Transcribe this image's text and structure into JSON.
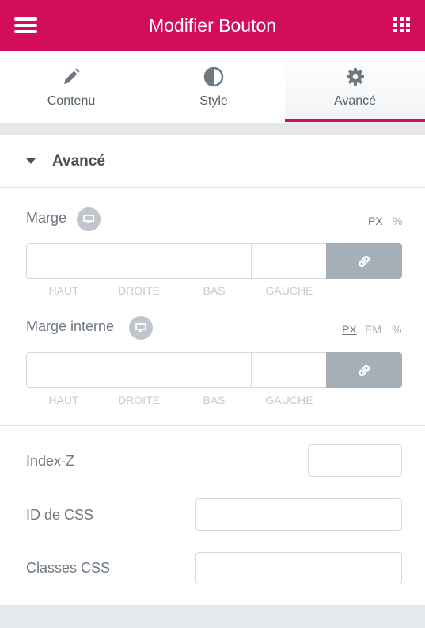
{
  "header": {
    "title": "Modifier Bouton",
    "menu_icon": "hamburger-icon",
    "grid_icon": "grid-icon",
    "accent_color": "#d30c5c"
  },
  "tabs": [
    {
      "label": "Contenu",
      "icon": "pencil-icon"
    },
    {
      "label": "Style",
      "icon": "half-circle-icon"
    },
    {
      "label": "Avancé",
      "icon": "gear-icon",
      "active": true
    }
  ],
  "section": {
    "title": "Avancé"
  },
  "margin": {
    "label": "Marge",
    "units": [
      "PX",
      "%"
    ],
    "selected_unit": "PX",
    "sides": [
      {
        "label": "HAUT",
        "value": ""
      },
      {
        "label": "DROITE",
        "value": ""
      },
      {
        "label": "BAS",
        "value": ""
      },
      {
        "label": "GAUCHE",
        "value": ""
      }
    ]
  },
  "padding": {
    "label": "Marge interne",
    "units": [
      "PX",
      "EM",
      "%"
    ],
    "selected_unit": "PX",
    "sides": [
      {
        "label": "HAUT",
        "value": ""
      },
      {
        "label": "DROITE",
        "value": ""
      },
      {
        "label": "BAS",
        "value": ""
      },
      {
        "label": "GAUCHE",
        "value": ""
      }
    ]
  },
  "fields": {
    "zindex_label": "Index-Z",
    "zindex_value": "",
    "cssid_label": "ID de CSS",
    "cssid_value": "",
    "cssclasses_label": "Classes CSS",
    "cssclasses_value": ""
  }
}
